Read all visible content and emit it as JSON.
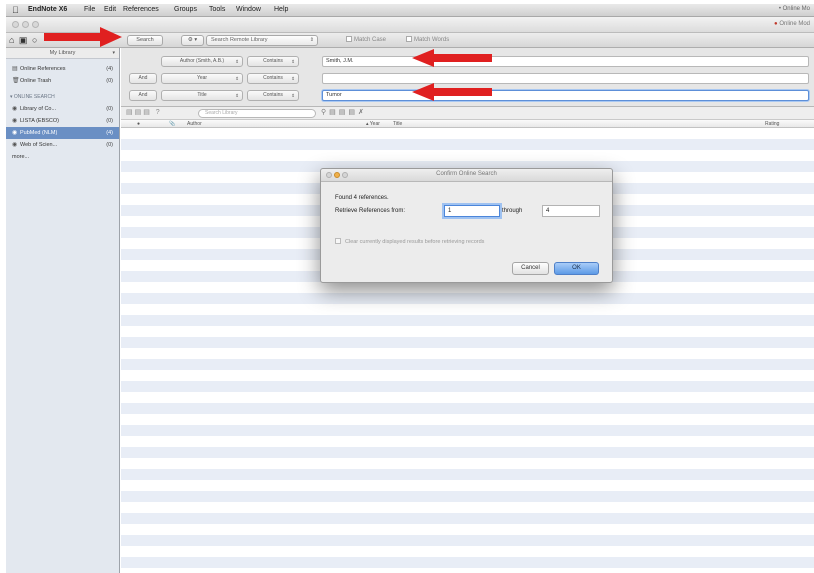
{
  "menubar": {
    "apple_glyph": "",
    "app_name": "EndNote X6",
    "items": [
      "File",
      "Edit",
      "References",
      "Groups",
      "Tools",
      "Window",
      "Help"
    ],
    "right_text": "• Online Mo"
  },
  "titlebar": {
    "right_link": "Online Mod"
  },
  "toolbar": {
    "mode_icons": "⌂ ▣ ○",
    "search_button": "Search",
    "options_button": "⚙ ▾",
    "search_scope": "Search Remote Library",
    "match_case": "Match Case",
    "match_words": "Match Words"
  },
  "sidebar": {
    "header": "My Library",
    "items": [
      {
        "label": "Online References",
        "count": "(4)",
        "icon": "online-references-icon"
      },
      {
        "label": "Online Trash",
        "count": "(0)",
        "icon": "trash-icon"
      }
    ],
    "group_label": "▾ ONLINE SEARCH",
    "search_items": [
      {
        "label": "Library of Co...",
        "count": "(0)"
      },
      {
        "label": "LISTA (EBSCO)",
        "count": "(0)"
      },
      {
        "label": "PubMed (NLM)",
        "count": "(4)",
        "selected": true
      },
      {
        "label": "Web of Scien...",
        "count": "(0)"
      }
    ],
    "more_label": "more..."
  },
  "search": {
    "rows": [
      {
        "bool": "",
        "field": "Author (Smith, A.B.)",
        "operator": "Contains",
        "value": "Smith, J.M."
      },
      {
        "bool": "And",
        "field": "Year",
        "operator": "Contains",
        "value": ""
      },
      {
        "bool": "And",
        "field": "Title",
        "operator": "Contains",
        "value": "Tumor"
      }
    ]
  },
  "library": {
    "quick_search_placeholder": "Search Library",
    "columns": [
      "●",
      "📎",
      "Author",
      "▴ Year",
      "Title",
      "Rating"
    ]
  },
  "dialog": {
    "title": "Confirm Online Search",
    "found_text": "Found 4 references.",
    "retrieve_label": "Retrieve References from:",
    "from_value": "1",
    "through_label": "through",
    "to_value": "4",
    "clear_option": "Clear currently displayed results before retrieving records",
    "cancel_label": "Cancel",
    "ok_label": "OK"
  },
  "colors": {
    "annotation_arrow": "#e02020",
    "selection": "#6a8fc4",
    "ok_button": "#5c9ae6"
  }
}
